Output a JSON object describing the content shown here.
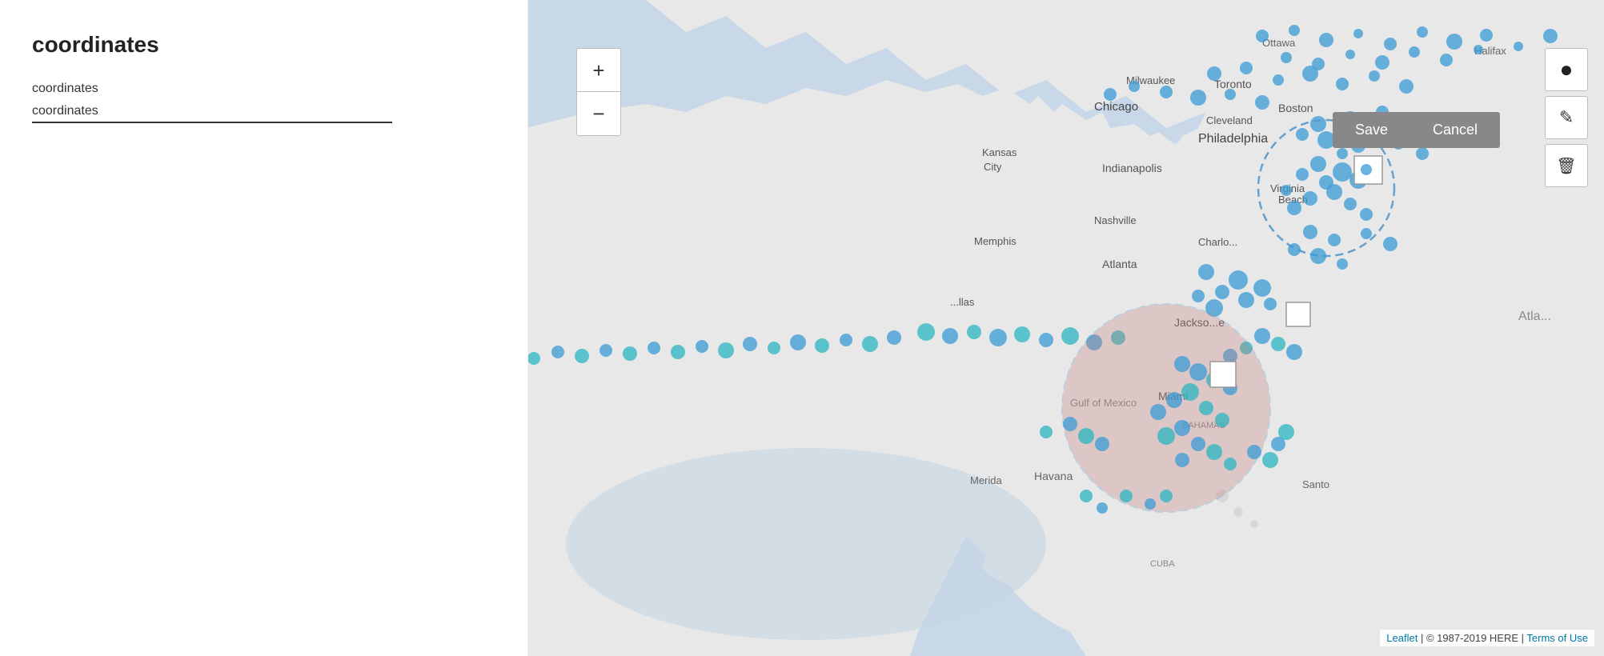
{
  "page": {
    "title": "coordinates",
    "field_label": "coordinates",
    "field_value": "coordinates"
  },
  "toolbar": {
    "save_label": "Save",
    "cancel_label": "Cancel"
  },
  "zoom": {
    "in_label": "+",
    "out_label": "−"
  },
  "icons": {
    "draw_circle": "●",
    "edit": "✎",
    "delete": "🗑"
  },
  "attribution": {
    "leaflet": "Leaflet",
    "copyright": " | © 1987-2019 HERE | ",
    "terms": "Terms of Use"
  },
  "map": {
    "cities": [
      "Ottawa",
      "Halifax",
      "Toronto",
      "Boston",
      "Milwaukee",
      "Philadelphia",
      "Chicago",
      "Cleveland",
      "Indianapolis",
      "Kansas City",
      "Nashville",
      "Memphis",
      "Charlotte",
      "Atlanta",
      "Dallas",
      "Jacksonville",
      "Miami",
      "Havana",
      "Merida",
      "Santo Domingo",
      "Virginia Beach"
    ],
    "ocean_label": "Atla",
    "gulf_label": "Gulf of Mexico",
    "bahamas_label": "BAHAMAS",
    "cuba_label": "CUBA"
  }
}
